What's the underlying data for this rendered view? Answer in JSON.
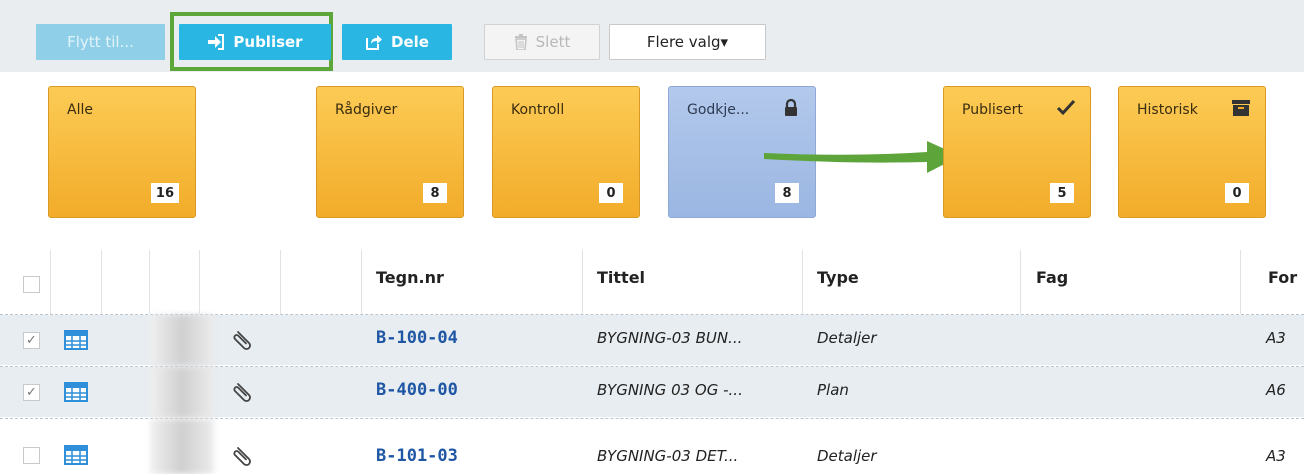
{
  "toolbar": {
    "move_label": "Flytt til...",
    "publish_label": "Publiser",
    "share_label": "Dele",
    "delete_label": "Slett",
    "more_label": "Flere valg▾"
  },
  "status_tiles": [
    {
      "label": "Alle",
      "count": "16",
      "icon": ""
    },
    {
      "label": "Rådgiver",
      "count": "8",
      "icon": ""
    },
    {
      "label": "Kontroll",
      "count": "0",
      "icon": ""
    },
    {
      "label": "Godkje...",
      "count": "8",
      "icon": "lock-icon"
    },
    {
      "label": "Publisert",
      "count": "5",
      "icon": "checkmark-icon"
    },
    {
      "label": "Historisk",
      "count": "0",
      "icon": "archive-icon"
    }
  ],
  "colors": {
    "tile_orange": "#f2ac2a",
    "tile_blue": "#9ab6e2",
    "button_blue": "#2ab6e3",
    "highlight_green": "#5ca63a",
    "link_blue": "#1f57a5"
  },
  "table": {
    "columns": [
      "Tegn.nr",
      "Tittel",
      "Type",
      "Fag",
      "For"
    ],
    "rows": [
      {
        "checked": true,
        "tegn_nr": "B-100-04",
        "tittel": "BYGNING-03 BUN...",
        "type": "Detaljer",
        "fag": "",
        "format": "A3"
      },
      {
        "checked": true,
        "tegn_nr": "B-400-00",
        "tittel": "BYGNING 03 OG -...",
        "type": "Plan",
        "fag": "",
        "format": "A6"
      },
      {
        "checked": false,
        "tegn_nr": "B-101-03",
        "tittel": "BYGNING-03 DET...",
        "type": "Detaljer",
        "fag": "",
        "format": "A3"
      }
    ]
  }
}
